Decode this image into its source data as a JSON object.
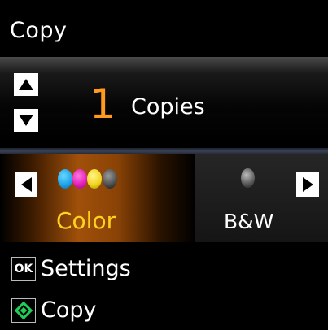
{
  "header": {
    "title": "Copy"
  },
  "copies": {
    "count": "1",
    "label": "Copies"
  },
  "modes": {
    "color_label": "Color",
    "bw_label": "B&W",
    "selected": "Color"
  },
  "actions": {
    "ok_key": "OK",
    "settings_label": "Settings",
    "copy_label": "Copy"
  },
  "colors": {
    "accent": "#ff9a1e",
    "selected_text": "#ffd21e",
    "start_green": "#1fcf5a"
  }
}
